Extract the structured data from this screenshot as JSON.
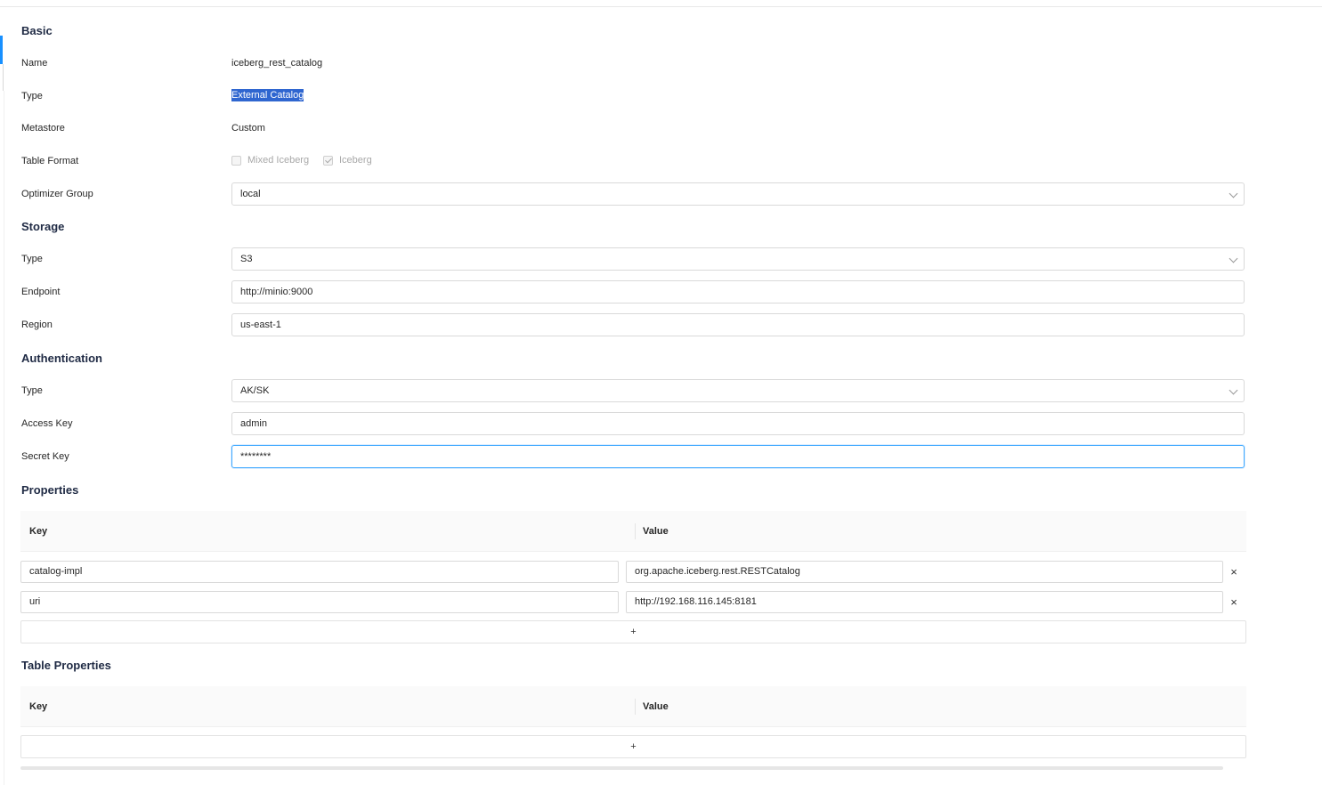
{
  "basic": {
    "title": "Basic",
    "name_label": "Name",
    "name_value": "iceberg_rest_catalog",
    "type_label": "Type",
    "type_value": "External Catalog",
    "metastore_label": "Metastore",
    "metastore_value": "Custom",
    "table_format_label": "Table Format",
    "table_format_options": [
      {
        "label": "Mixed Iceberg",
        "checked": false
      },
      {
        "label": "Iceberg",
        "checked": true
      }
    ],
    "optimizer_group_label": "Optimizer Group",
    "optimizer_group_value": "local"
  },
  "storage": {
    "title": "Storage",
    "type_label": "Type",
    "type_value": "S3",
    "endpoint_label": "Endpoint",
    "endpoint_value": "http://minio:9000",
    "region_label": "Region",
    "region_value": "us-east-1"
  },
  "authentication": {
    "title": "Authentication",
    "type_label": "Type",
    "type_value": "AK/SK",
    "access_key_label": "Access Key",
    "access_key_value": "admin",
    "secret_key_label": "Secret Key",
    "secret_key_value": "********"
  },
  "properties": {
    "title": "Properties",
    "key_header": "Key",
    "value_header": "Value",
    "rows": [
      {
        "key": "catalog-impl",
        "value": "org.apache.iceberg.rest.RESTCatalog"
      },
      {
        "key": "uri",
        "value": "http://192.168.116.145:8181"
      }
    ],
    "remove_icon": "×",
    "add_label": "+"
  },
  "table_properties": {
    "title": "Table Properties",
    "key_header": "Key",
    "value_header": "Value",
    "add_label": "+"
  },
  "colors": {
    "accent": "#1890ff",
    "selection": "#2f66d0",
    "border": "#d9d9d9"
  }
}
